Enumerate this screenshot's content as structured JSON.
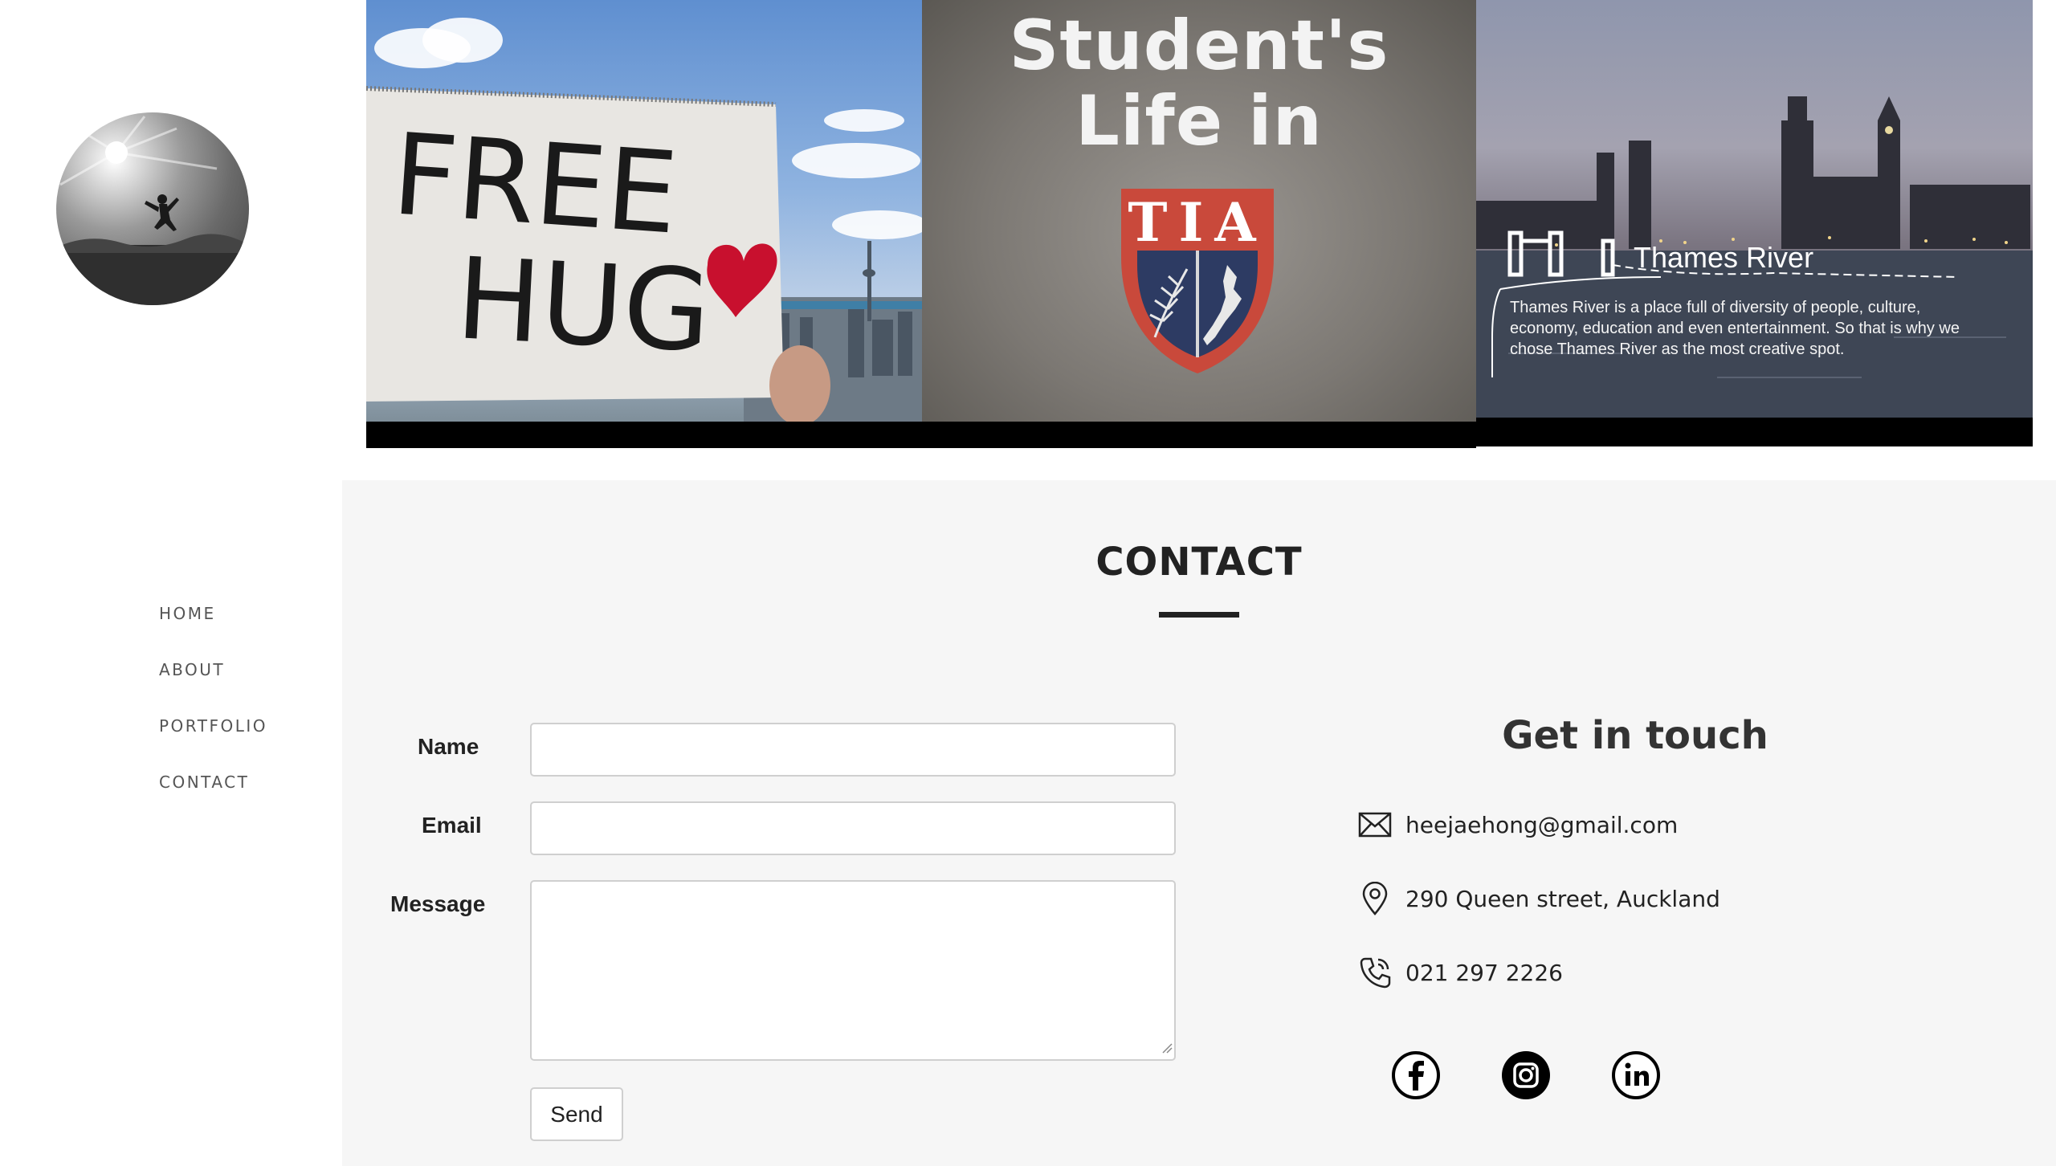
{
  "sidebar": {
    "nav": [
      {
        "label": "HOME"
      },
      {
        "label": "ABOUT"
      },
      {
        "label": "PORTFOLIO"
      },
      {
        "label": "CONTACT"
      }
    ]
  },
  "banner": {
    "tile1": {
      "sign_line1": "FREE",
      "sign_line2": "HUG"
    },
    "tile2": {
      "title_line1": "Student's",
      "title_line2": "Life in",
      "crest_text": "TIA"
    },
    "tile3": {
      "title": "Thames River",
      "text": "Thames River is a place full of diversity of people, culture, economy, education and even entertainment. So that is why we chose Thames River as the most creative spot."
    }
  },
  "contact": {
    "title": "CONTACT",
    "form": {
      "name_label": "Name",
      "email_label": "Email",
      "message_label": "Message",
      "name_value": "",
      "email_value": "",
      "message_value": "",
      "send_label": "Send"
    },
    "get_in_touch": {
      "title": "Get in touch",
      "email": "heejaehong@gmail.com",
      "address": "290 Queen street, Auckland",
      "phone": "021 297 2226"
    },
    "social": [
      {
        "icon": "facebook-icon"
      },
      {
        "icon": "instagram-icon"
      },
      {
        "icon": "linkedin-icon"
      }
    ]
  },
  "colors": {
    "section_bg": "#f6f6f6",
    "text": "#222222",
    "nav_text": "#555555",
    "crest_red": "#c9493b",
    "crest_navy": "#2d3b63",
    "heart": "#c8102e"
  }
}
